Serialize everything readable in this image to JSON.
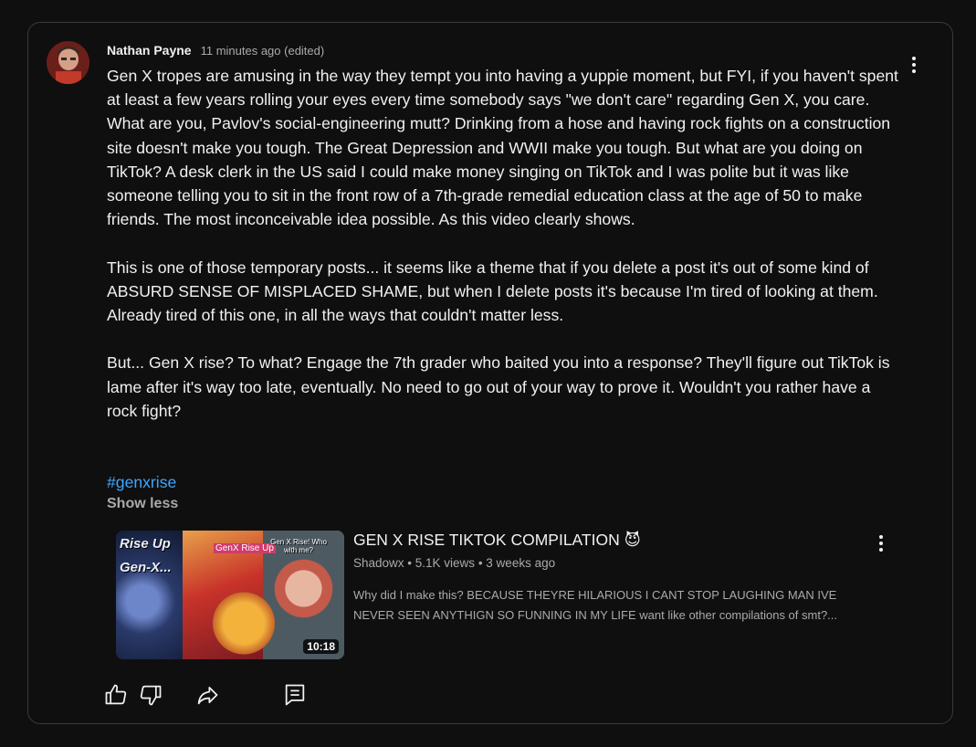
{
  "comment": {
    "author": "Nathan Payne",
    "timestamp": "11 minutes ago (edited)",
    "paragraphs": [
      "Gen X tropes are amusing in the way they tempt you into having a yuppie moment, but FYI, if you haven't spent at least a few years rolling your eyes every time somebody says \"we don't care\" regarding Gen X, you care.  What are you, Pavlov's social-engineering mutt?  Drinking from a hose and having rock fights on a construction site doesn't make you tough.  The Great Depression and WWII make you tough.  But what are you doing on TikTok?  A desk clerk in the US said I could make money singing on TikTok and I was polite but it was like someone telling you to sit in the front row of a 7th-grade remedial education class at the age of 50 to make friends.  The most inconceivable idea possible.  As this video clearly shows.",
      "This is one of those temporary posts... it seems like a theme that if you delete a post it's out of some kind of ABSURD SENSE OF MISPLACED SHAME, but when I delete posts it's because I'm tired of looking at them.  Already tired of this one, in all the ways that couldn't matter less.",
      "But... Gen X rise?  To what?  Engage the 7th grader who baited you into a response?  They'll figure out TikTok is lame after it's way too late, eventually.  No need to go out of your way to prove it.  Wouldn't you rather have a rock fight?"
    ],
    "hashtag": "#genxrise",
    "show_less": "Show less",
    "menu_icon": "more-vert-icon"
  },
  "video": {
    "title": "GEN X RISE TIKTOK COMPILATION 😈",
    "channel": "Shadowx",
    "views": "5.1K views",
    "age": "3 weeks ago",
    "separator": " • ",
    "description": "Why did I make this? BECAUSE THEYRE HILARIOUS I CANT STOP LAUGHING MAN IVE NEVER SEEN ANYTHIGN SO FUNNING IN MY LIFE want like other compilations of smt?...",
    "duration": "10:18",
    "thumb_text_1": "Rise Up",
    "thumb_text_2": "Gen-X...",
    "thumb_text_3": "GenX Rise Up",
    "thumb_text_4": "Gen X Rise! Who with me?"
  },
  "actions": {
    "like_icon": "thumbs-up-icon",
    "dislike_icon": "thumbs-down-icon",
    "share_icon": "share-icon",
    "reply_icon": "comment-icon"
  },
  "colors": {
    "background": "#0f0f0f",
    "border": "#3a3a3a",
    "text": "#f1f1f1",
    "secondary": "#aaaaaa",
    "link": "#3ea6ff"
  }
}
